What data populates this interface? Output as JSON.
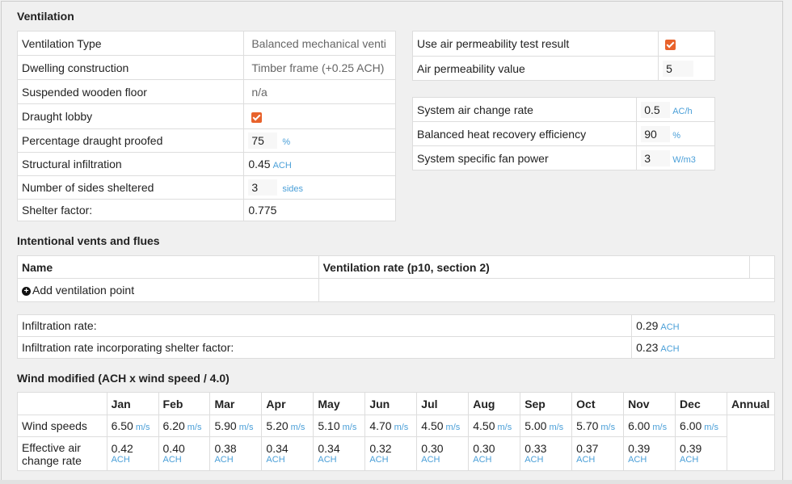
{
  "ventilation": {
    "title": "Ventilation",
    "left_rows": [
      {
        "label": "Ventilation Type",
        "value": "Balanced mechanical venti"
      },
      {
        "label": "Dwelling construction",
        "value": "Timber frame (+0.25 ACH)"
      },
      {
        "label": "Suspended wooden floor",
        "value": "n/a"
      },
      {
        "label": "Draught lobby",
        "checked": true
      },
      {
        "label": "Percentage draught proofed",
        "value": "75",
        "unit": "%"
      },
      {
        "label": "Structural infiltration",
        "value": "0.45",
        "unit": "ACH"
      },
      {
        "label": "Number of sides sheltered",
        "value": "3",
        "unit": "sides"
      },
      {
        "label": "Shelter factor:",
        "value": "0.775"
      }
    ],
    "permeability": [
      {
        "label": "Use air permeability test result",
        "checked": true
      },
      {
        "label": "Air permeability value",
        "value": "5"
      }
    ],
    "system": [
      {
        "label": "System air change rate",
        "value": "0.5",
        "unit": "AC/h"
      },
      {
        "label": "Balanced heat recovery efficiency",
        "value": "90",
        "unit": "%"
      },
      {
        "label": "System specific fan power",
        "value": "3",
        "unit": "W/m3"
      }
    ]
  },
  "vents": {
    "title": "Intentional vents and flues",
    "col_name": "Name",
    "col_rate": "Ventilation rate (p10, section 2)",
    "add_label": "Add ventilation point"
  },
  "infiltration": {
    "rate_label": "Infiltration rate:",
    "rate_value": "0.29",
    "rate_unit": "ACH",
    "shelter_label": "Infiltration rate incorporating shelter factor:",
    "shelter_value": "0.23",
    "shelter_unit": "ACH"
  },
  "wind": {
    "title": "Wind modified (ACH x wind speed / 4.0)",
    "months": [
      "Jan",
      "Feb",
      "Mar",
      "Apr",
      "May",
      "Jun",
      "Jul",
      "Aug",
      "Sep",
      "Oct",
      "Nov",
      "Dec"
    ],
    "annual_label": "Annual",
    "speed_label": "Wind speeds",
    "speed_unit": "m/s",
    "speeds": [
      "6.50",
      "6.20",
      "5.90",
      "5.20",
      "5.10",
      "4.70",
      "4.50",
      "4.50",
      "5.00",
      "5.70",
      "6.00",
      "6.00"
    ],
    "eff_label": "Effective air change rate",
    "eff_unit": "ACH",
    "eff": [
      "0.42",
      "0.40",
      "0.38",
      "0.34",
      "0.34",
      "0.32",
      "0.30",
      "0.30",
      "0.33",
      "0.37",
      "0.39",
      "0.39"
    ]
  },
  "colors": {
    "accent": "#e8622b",
    "unit": "#4a9fd8",
    "background": "#f0f0f0"
  }
}
